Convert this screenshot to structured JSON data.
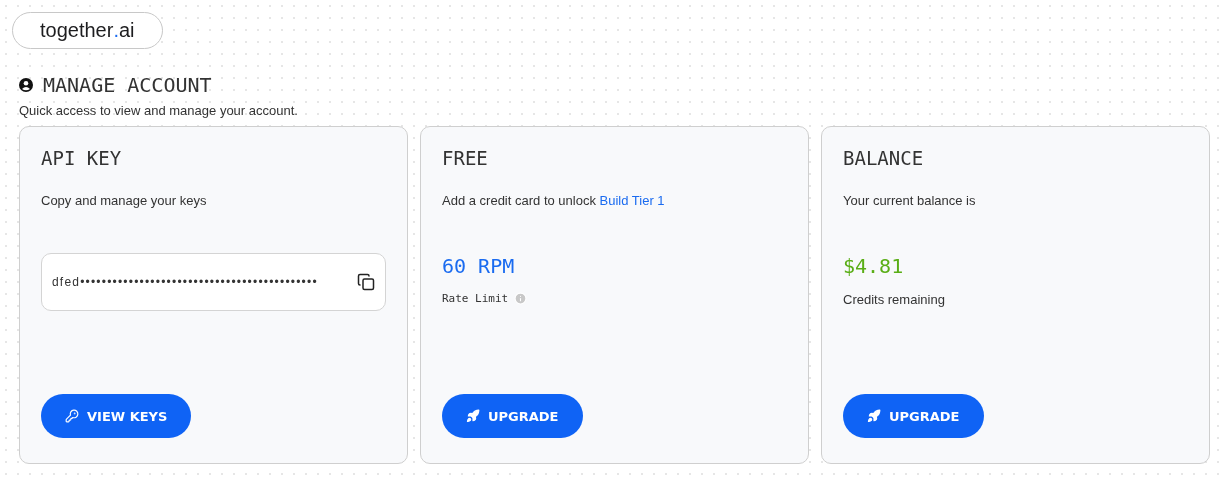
{
  "logo": {
    "name": "together",
    "dot": ".",
    "suffix": "ai"
  },
  "section": {
    "title": "MANAGE ACCOUNT",
    "subtitle": "Quick access to view and manage your account."
  },
  "cards": [
    {
      "kind": "key",
      "title": "API KEY",
      "description": "Copy and manage your keys",
      "key_value": "dfed••••••••••••••••••••••••••••••••••••••••••••",
      "button": {
        "label": "VIEW KEYS"
      }
    },
    {
      "kind": "plan",
      "title": "FREE",
      "description": "Add a credit card to unlock",
      "link": "Build Tier 1",
      "figure": "60 RPM",
      "figure_label": "Rate Limit",
      "button": {
        "label": "UPGRADE"
      }
    },
    {
      "kind": "balance",
      "title": "BALANCE",
      "description": "Your current balance is",
      "figure": "$4.81",
      "figure_label": "Credits remaining",
      "button": {
        "label": "UPGRADE"
      }
    }
  ]
}
